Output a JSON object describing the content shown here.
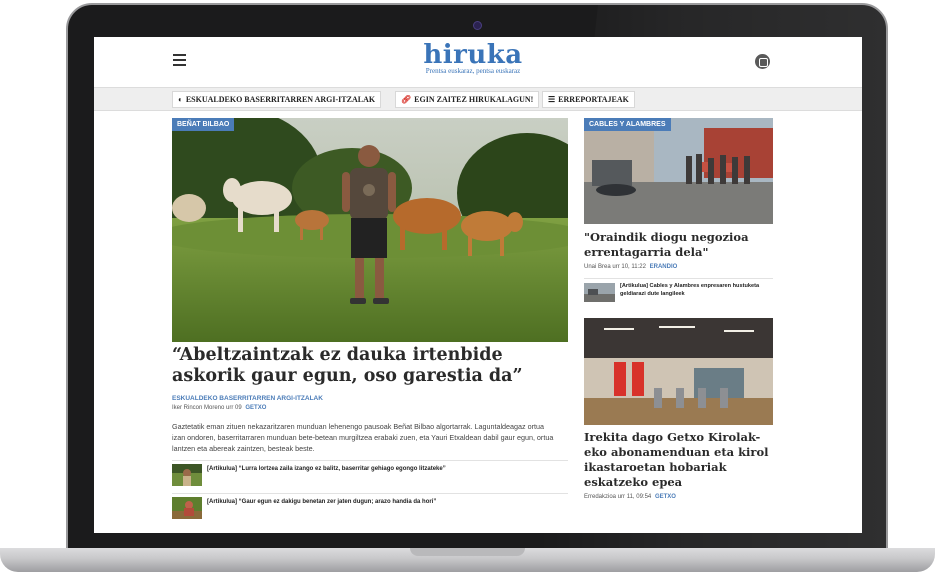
{
  "site": {
    "logo": "hiruka",
    "tagline": "Prentsa euskaraz, pentsa euskaraz"
  },
  "nav": {
    "items": [
      {
        "icon": "globe-icon",
        "label": "ESKUALDEKO BASERRITARREN ARGI-ITZALAK"
      },
      {
        "icon": "link-icon",
        "label": "EGIN ZAITEZ HIRUKALAGUN!"
      },
      {
        "icon": "list-icon",
        "label": "ERREPORTAJEAK"
      }
    ]
  },
  "main": {
    "badge": "BEÑAT BILBAO",
    "headline": "“Abeltzaintzak ez dauka irtenbide askorik gaur egun, oso garestia da”",
    "kicker": "ESKUALDEKO BASERRITARREN ARGI-ITZALAK",
    "byline": "Iker Rincon Moreno",
    "date": "urr 09",
    "location": "GETXO",
    "summary": "Gaztetatik eman zituen nekazaritzaren munduan lehenengo pausoak Beñat Bilbao algortarrak. Laguntaldeagaz ortua izan ondoren, baserritarraren munduan bete-betean murgiltzea erabaki zuen, eta Yauri Etxaldean dabil gaur egun, ortua lantzen eta abereak zaintzen, besteak beste.",
    "related": [
      "[Artikulua] “Lurra lortzea zaila izango ez balitz, baserritar gehiago egongo litzateke”",
      "[Artikulua] “Gaur egun ez dakigu benetan zer jaten dugun; arazo handia da hori”"
    ]
  },
  "side1": {
    "badge": "CABLES Y ALAMBRES",
    "headline": "\"Oraindik diogu negozioa errentagarria dela\"",
    "byline": "Unai Brea",
    "date": "urr 10, 11:22",
    "location": "ERANDIO",
    "related": "[Artikulua] Cables y Alambres enpresaren hustuketa geldiarazi dute langileek"
  },
  "side2": {
    "headline": "Irekita dago Getxo Kirolak-eko abonamenduan eta kirol ikastaroetan hobariak eskatzeko epea",
    "byline": "Erredakzioa",
    "date": "urr 11, 09:54",
    "location": "GETXO"
  },
  "colors": {
    "brand": "#3a74b8",
    "badge": "#4b7cb8",
    "link_red": "#d8322a"
  }
}
